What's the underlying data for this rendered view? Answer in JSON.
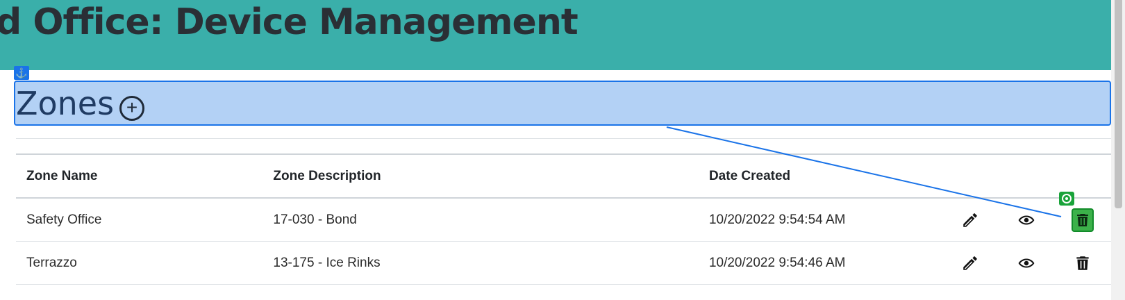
{
  "header": {
    "title": "d Office: Device Management"
  },
  "section": {
    "title": "Zones"
  },
  "table": {
    "headers": [
      "Zone Name",
      "Zone Description",
      "Date Created"
    ],
    "rows": [
      {
        "name": "Safety Office",
        "description": "17-030 - Bond",
        "date": "10/20/2022 9:54:54 AM"
      },
      {
        "name": "Terrazzo",
        "description": "13-175 - Ice Rinks",
        "date": "10/20/2022 9:54:46 AM"
      }
    ]
  },
  "icons": {
    "anchor": "anchor-icon",
    "add": "plus-circle-icon",
    "edit": "pencil-icon",
    "view": "eye-icon",
    "delete": "trash-icon",
    "target": "target-icon"
  },
  "colors": {
    "header_bg": "#3aafaa",
    "selection_bg": "#b3d1f5",
    "selection_border": "#1a73e8",
    "highlight_green": "#3cb14a"
  }
}
